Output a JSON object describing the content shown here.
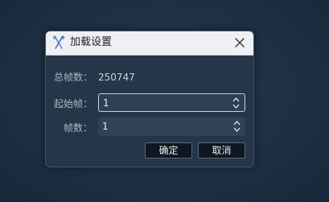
{
  "dialog": {
    "title": "加载设置",
    "icon": "tools-icon",
    "close_icon": "close-icon"
  },
  "form": {
    "total_frames_label": "总帧数：",
    "total_frames_value": "250747",
    "start_frame_label": "起始帧：",
    "start_frame_value": "1",
    "frame_count_label": "帧数：",
    "frame_count_value": "1"
  },
  "buttons": {
    "ok_label": "确定",
    "cancel_label": "取消"
  },
  "colors": {
    "dialog_bg": "#253648",
    "titlebar_bg": "#eef0f4",
    "button_bg": "#0f1720"
  }
}
